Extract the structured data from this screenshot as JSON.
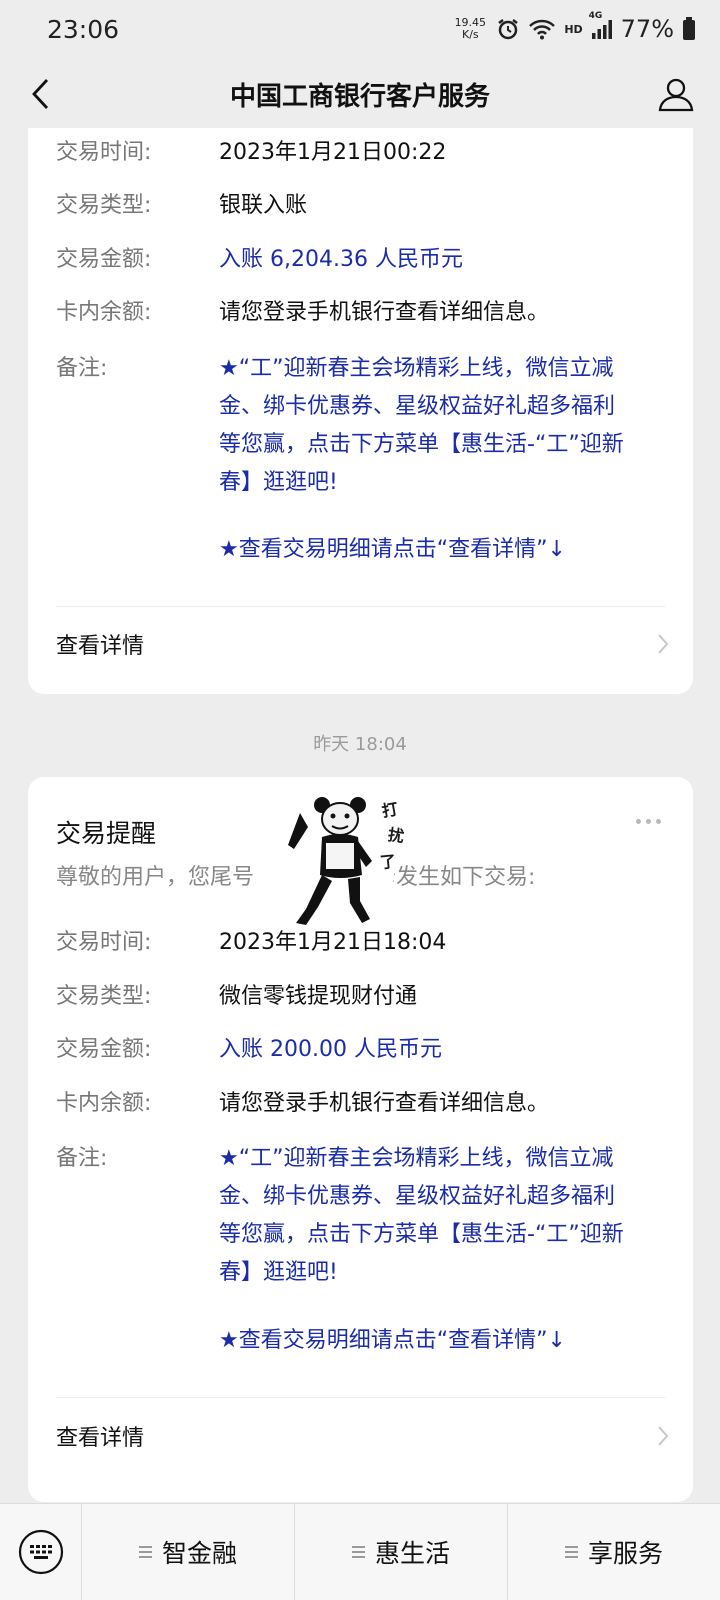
{
  "status_bar": {
    "time": "23:06",
    "net_speed_value": "19.45",
    "net_speed_unit": "K/s",
    "signal_label": "4G",
    "hd_label": "HD",
    "battery": "77%",
    "icons": [
      "alarm-icon",
      "wifi-icon",
      "signal-icon",
      "battery-icon"
    ]
  },
  "nav": {
    "title": "中国工商银行客户服务",
    "icons": [
      "back-icon",
      "profile-icon"
    ]
  },
  "message_1": {
    "rows": [
      {
        "label": "交易时间:",
        "value": "2023年1月21日00:22"
      },
      {
        "label": "交易类型:",
        "value": "银联入账"
      },
      {
        "label": "交易金额:",
        "value": "入账 6,204.36 人民币元"
      },
      {
        "label": "卡内余额:",
        "value": "请您登录手机银行查看详细信息。"
      }
    ],
    "remark_label": "备注:",
    "remark_lines": [
      "★“工”迎新春主会场精彩上线，微信立减",
      "金、绑卡优惠券、星级权益好礼超多福利",
      "等您赢，点击下方菜单【惠生活-“工”迎新",
      "春】逛逛吧!"
    ],
    "tip": "★查看交易明细请点击“查看详情”↓",
    "detail_link": "查看详情"
  },
  "timestamp": "昨天 18:04",
  "message_2": {
    "title": "交易提醒",
    "intro_start": "尊敬的用户，您尾号",
    "intro_end": "卡发生如下交易:",
    "rows": [
      {
        "label": "交易时间:",
        "value": "2023年1月21日18:04"
      },
      {
        "label": "交易类型:",
        "value": "微信零钱提现财付通"
      },
      {
        "label": "交易金额:",
        "value": "入账 200.00 人民币元"
      },
      {
        "label": "卡内余额:",
        "value": "请您登录手机银行查看详细信息。"
      }
    ],
    "remark_label": "备注:",
    "remark_lines": [
      "★“工”迎新春主会场精彩上线，微信立减",
      "金、绑卡优惠券、星级权益好礼超多福利",
      "等您赢，点击下方菜单【惠生活-“工”迎新",
      "春】逛逛吧!"
    ],
    "tip": "★查看交易明细请点击“查看详情”↓",
    "detail_link": "查看详情"
  },
  "sticker": {
    "caption_chars": [
      "打",
      "扰",
      "了"
    ],
    "icon": "panda-meme-sticker"
  },
  "bottom_menu": {
    "items": [
      "智金融",
      "惠生活",
      "享服务"
    ],
    "icons": [
      "keyboard-icon",
      "menu-lines-icon"
    ]
  },
  "colors": {
    "background": "#ededed",
    "card": "#ffffff",
    "link_blue": "#1c2ca8",
    "label_gray": "#777777"
  }
}
